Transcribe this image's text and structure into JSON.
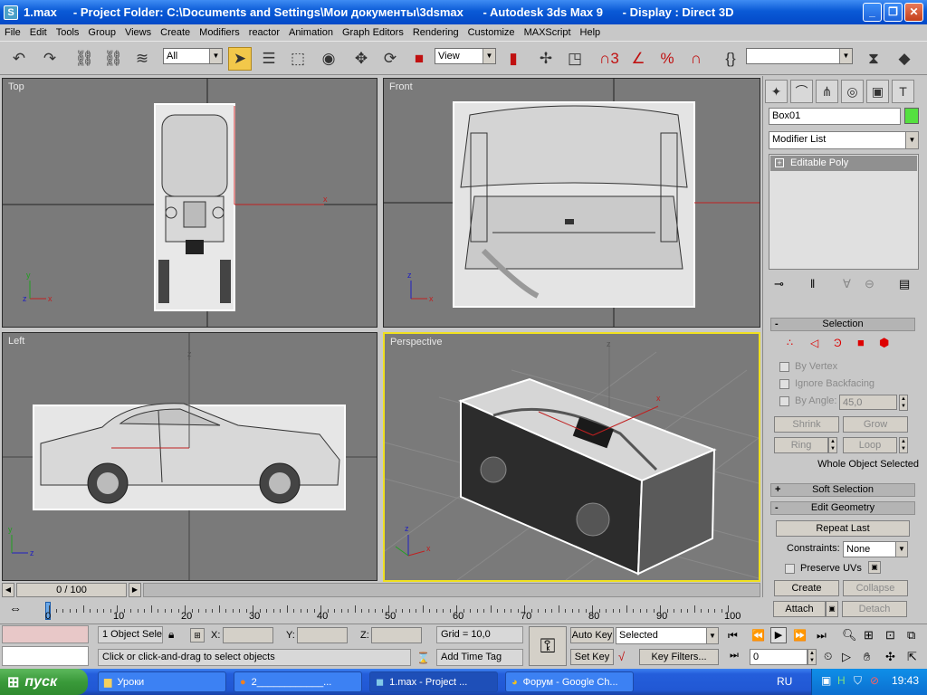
{
  "window": {
    "title": "1.max     - Project Folder: C:\\Documents and Settings\\Мои документы\\3dsmax      - Autodesk 3ds Max 9      - Display : Direct 3D",
    "app_icon": "3ds-max-icon"
  },
  "menu": [
    "File",
    "Edit",
    "Tools",
    "Group",
    "Views",
    "Create",
    "Modifiers",
    "reactor",
    "Animation",
    "Graph Editors",
    "Rendering",
    "Customize",
    "MAXScript",
    "Help"
  ],
  "toolbar": {
    "filter_select": "All",
    "ref_coord_select": "View",
    "named_selection_value": ""
  },
  "viewports": {
    "top": {
      "label": "Top"
    },
    "front": {
      "label": "Front"
    },
    "left": {
      "label": "Left"
    },
    "perspective": {
      "label": "Perspective"
    },
    "axes": {
      "x": "x",
      "y": "y",
      "z": "z"
    }
  },
  "command_panel": {
    "object_name": "Box01",
    "object_color": "#55e040",
    "modifier_list": "Modifier List",
    "stack_item": "Editable Poly",
    "selection": {
      "title": "Selection",
      "by_vertex": "By Vertex",
      "ignore_backfacing": "Ignore Backfacing",
      "by_angle": "By Angle:",
      "angle_value": "45,0",
      "shrink": "Shrink",
      "grow": "Grow",
      "ring": "Ring",
      "loop": "Loop",
      "status": "Whole Object Selected"
    },
    "soft_selection": {
      "title": "Soft Selection"
    },
    "edit_geometry": {
      "title": "Edit Geometry",
      "repeat_last": "Repeat Last",
      "constraints_label": "Constraints:",
      "constraints_value": "None",
      "preserve_uvs": "Preserve UVs",
      "create": "Create",
      "collapse": "Collapse",
      "attach": "Attach",
      "detach": "Detach"
    },
    "collapse_signs": {
      "open": "-",
      "closed": "+"
    }
  },
  "timeline": {
    "frame_label": "0 / 100",
    "ticks": [
      "0",
      "10",
      "20",
      "30",
      "40",
      "50",
      "60",
      "70",
      "80",
      "90",
      "100"
    ]
  },
  "status": {
    "selected_objects": "1 Object Sele",
    "prompt": "Click or click-and-drag to select objects",
    "x_label": "X:",
    "y_label": "Y:",
    "z_label": "Z:",
    "grid": "Grid = 10,0",
    "add_time_tag": "Add Time Tag",
    "auto_key": "Auto Key",
    "set_key": "Set Key",
    "key_mode_value": "Selected",
    "key_filters": "Key Filters...",
    "current_frame": "0"
  },
  "taskbar": {
    "start": "пуск",
    "tasks": [
      {
        "label": "Уроки",
        "icon": "folder-icon"
      },
      {
        "label": "2____________...",
        "icon": "firefox-icon"
      },
      {
        "label": "1.max     - Project ...",
        "icon": "3ds-max-icon"
      },
      {
        "label": "Форум - Google Ch...",
        "icon": "chrome-icon"
      }
    ],
    "language": "RU",
    "clock": "19:43"
  }
}
